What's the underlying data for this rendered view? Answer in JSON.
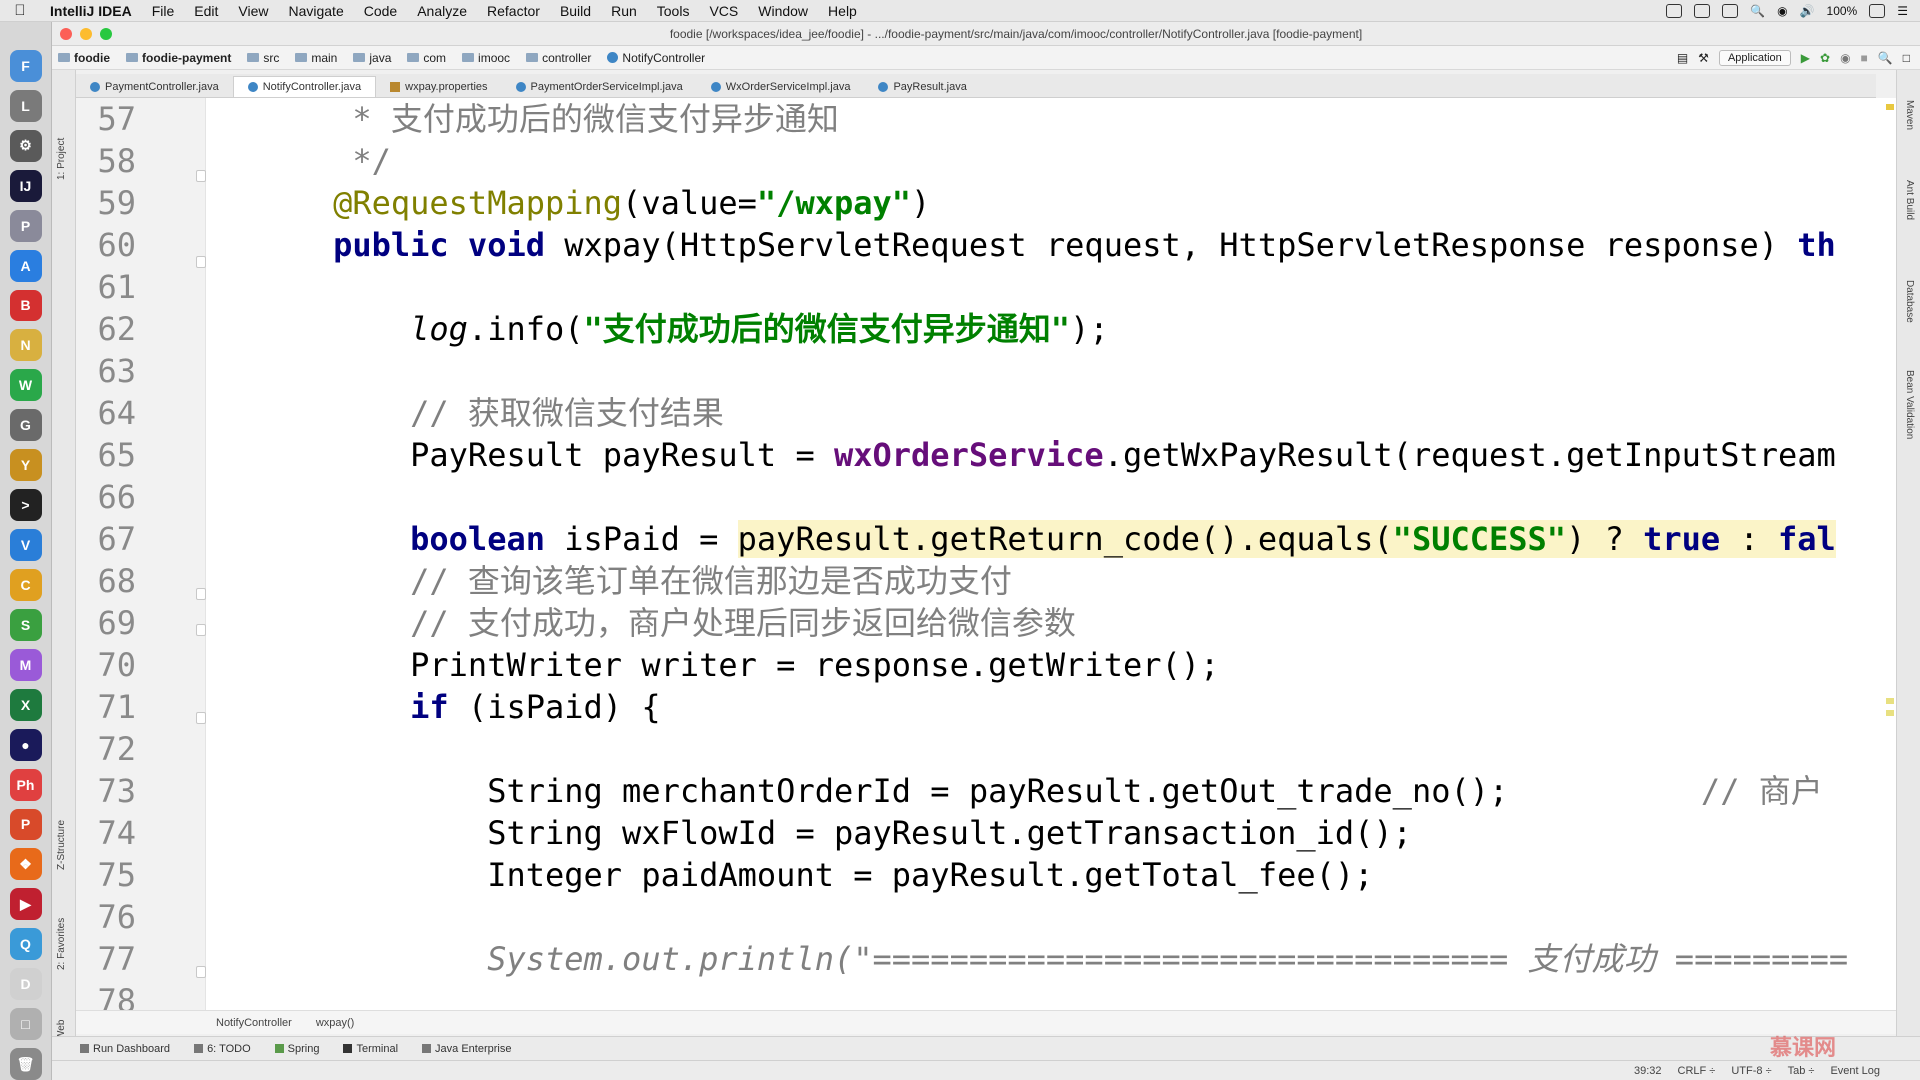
{
  "menubar": {
    "app_name": "IntelliJ IDEA",
    "items": [
      "File",
      "Edit",
      "View",
      "Navigate",
      "Code",
      "Analyze",
      "Refactor",
      "Build",
      "Run",
      "Tools",
      "VCS",
      "Window",
      "Help"
    ],
    "battery": "100%"
  },
  "window": {
    "title": "foodie [/workspaces/idea_jee/foodie] - .../foodie-payment/src/main/java/com/imooc/controller/NotifyController.java [foodie-payment]"
  },
  "navbar": {
    "breadcrumbs": [
      "foodie",
      "foodie-payment",
      "src",
      "main",
      "java",
      "com",
      "imooc",
      "controller",
      "NotifyController"
    ],
    "run_config": "Application"
  },
  "tabs": [
    {
      "label": "PaymentController.java",
      "icon": "class-icon",
      "active": false
    },
    {
      "label": "NotifyController.java",
      "icon": "class-icon",
      "active": true
    },
    {
      "label": "wxpay.properties",
      "icon": "properties-icon",
      "active": false
    },
    {
      "label": "PaymentOrderServiceImpl.java",
      "icon": "class-icon",
      "active": false
    },
    {
      "label": "WxOrderServiceImpl.java",
      "icon": "class-icon",
      "active": false
    },
    {
      "label": "PayResult.java",
      "icon": "class-icon",
      "active": false
    }
  ],
  "left_tool_labels": {
    "project": "1: Project",
    "structure": "Z-Structure",
    "favorites": "2: Favorites",
    "web": "Web"
  },
  "right_tool_labels": {
    "maven": "Maven",
    "ant": "Ant Build",
    "database": "Database",
    "bean": "Bean Validation"
  },
  "code_lines": [
    {
      "num": "57",
      "tokens": [
        {
          "t": "     * 支付成功后的微信支付异步通知",
          "k": "comment"
        }
      ]
    },
    {
      "num": "58",
      "tokens": [
        {
          "t": "     */",
          "k": "comment"
        }
      ]
    },
    {
      "num": "59",
      "tokens": [
        {
          "t": "    @RequestMapping",
          "k": "annotation"
        },
        {
          "t": "(value=",
          "k": "plain"
        },
        {
          "t": "\"/wxpay\"",
          "k": "string"
        },
        {
          "t": ")",
          "k": "plain"
        }
      ]
    },
    {
      "num": "60",
      "tokens": [
        {
          "t": "    public void ",
          "k": "keyword"
        },
        {
          "t": "wxpay(HttpServletRequest request, HttpServletResponse response) ",
          "k": "plain"
        },
        {
          "t": "th",
          "k": "keyword"
        }
      ]
    },
    {
      "num": "61",
      "tokens": []
    },
    {
      "num": "62",
      "tokens": [
        {
          "t": "        ",
          "k": "plain"
        },
        {
          "t": "log",
          "k": "static"
        },
        {
          "t": ".info(",
          "k": "plain"
        },
        {
          "t": "\"支付成功后的微信支付异步通知\"",
          "k": "string"
        },
        {
          "t": ");",
          "k": "plain"
        }
      ]
    },
    {
      "num": "63",
      "tokens": []
    },
    {
      "num": "64",
      "tokens": [
        {
          "t": "        // 获取微信支付结果",
          "k": "comment"
        }
      ]
    },
    {
      "num": "65",
      "tokens": [
        {
          "t": "        PayResult payResult = ",
          "k": "plain"
        },
        {
          "t": "wxOrderService",
          "k": "field"
        },
        {
          "t": ".getWxPayResult(request.getInputStream",
          "k": "plain"
        }
      ]
    },
    {
      "num": "66",
      "tokens": []
    },
    {
      "num": "67",
      "tokens": [
        {
          "t": "        ",
          "k": "plain"
        },
        {
          "t": "boolean ",
          "k": "keyword"
        },
        {
          "t": "isPaid = ",
          "k": "plain"
        },
        {
          "t": "payResult.getReturn_code().equals(",
          "k": "hlplain"
        },
        {
          "t": "\"SUCCESS\"",
          "k": "hlstring"
        },
        {
          "t": ") ? ",
          "k": "hlplain"
        },
        {
          "t": "true",
          "k": "hlkeyword"
        },
        {
          "t": " : ",
          "k": "hlplain"
        },
        {
          "t": "fal",
          "k": "hlkeyword"
        }
      ]
    },
    {
      "num": "68",
      "tokens": [
        {
          "t": "        // 查询该笔订单在微信那边是否成功支付",
          "k": "comment"
        }
      ]
    },
    {
      "num": "69",
      "tokens": [
        {
          "t": "        // 支付成功，商户处理后同步返回给微信参数",
          "k": "comment"
        }
      ]
    },
    {
      "num": "70",
      "tokens": [
        {
          "t": "        PrintWriter writer = response.getWriter();",
          "k": "plain"
        }
      ]
    },
    {
      "num": "71",
      "tokens": [
        {
          "t": "        ",
          "k": "plain"
        },
        {
          "t": "if ",
          "k": "keyword"
        },
        {
          "t": "(isPaid) {",
          "k": "plain"
        }
      ]
    },
    {
      "num": "72",
      "tokens": []
    },
    {
      "num": "73",
      "tokens": [
        {
          "t": "            String merchantOrderId = payResult.getOut_trade_no();",
          "k": "plain"
        },
        {
          "t": "          // 商户",
          "k": "comment"
        }
      ]
    },
    {
      "num": "74",
      "tokens": [
        {
          "t": "            String wxFlowId = payResult.getTransaction_id();",
          "k": "plain"
        }
      ]
    },
    {
      "num": "75",
      "tokens": [
        {
          "t": "            Integer paidAmount = payResult.getTotal_fee();",
          "k": "plain"
        }
      ]
    },
    {
      "num": "76",
      "tokens": []
    },
    {
      "num": "77",
      "tokens": [
        {
          "t": "            System.out.println(\"================================= 支付成功 =========",
          "k": "italic"
        }
      ]
    },
    {
      "num": "78",
      "tokens": []
    }
  ],
  "footer_breadcrumb": [
    "NotifyController",
    "wxpay()"
  ],
  "toolwindows": [
    "Run Dashboard",
    "6: TODO",
    "Spring",
    "Terminal",
    "Java Enterprise"
  ],
  "status": {
    "position": "39:32",
    "line_sep": "CRLF ÷",
    "encoding": "UTF-8 ÷",
    "indent": "Tab ÷",
    "event_log": "Event Log"
  },
  "watermark": "慕课网",
  "colors": {
    "keyword": "#000080",
    "string": "#008000",
    "annotation": "#808000",
    "comment": "#808080",
    "field": "#660e7a",
    "highlight": "#fbf4c8"
  }
}
